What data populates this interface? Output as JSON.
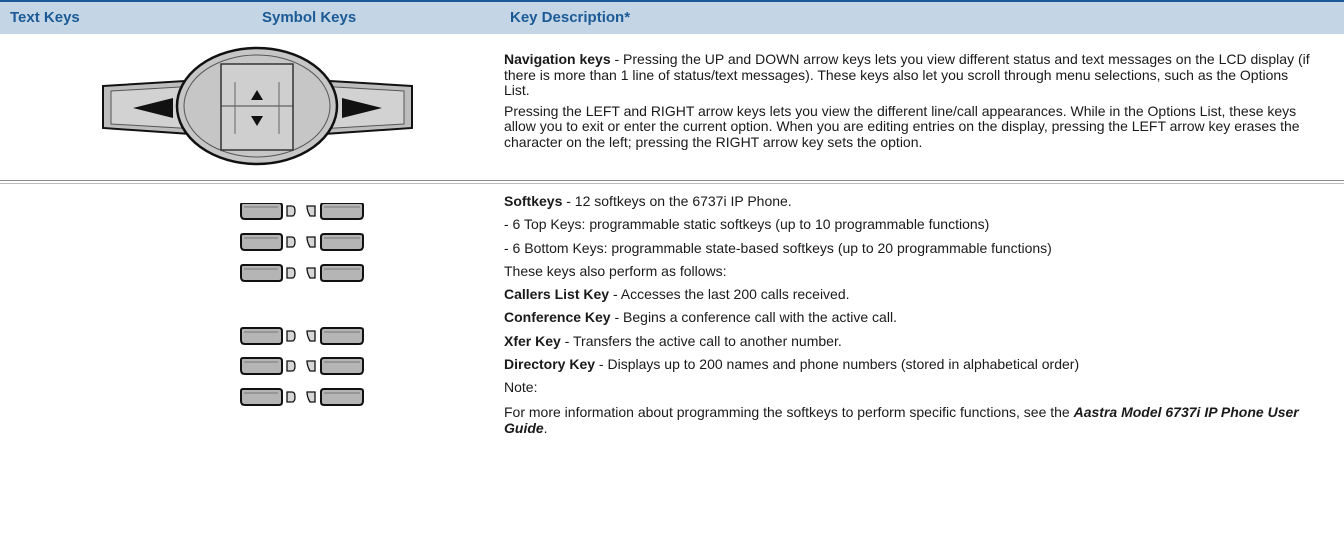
{
  "header": {
    "col1": "Text Keys",
    "col2": "Symbol Keys",
    "col3": "Key Description*"
  },
  "nav": {
    "title": "Navigation keys",
    "text1": " - Pressing the UP and DOWN arrow keys lets you view different status and text messages on the LCD display (if there is more than 1 line of status/text messages). These keys also let you scroll through menu selections, such as the Options List.",
    "text2": "Pressing the LEFT and RIGHT arrow keys lets you view the different line/call appearances. While in the Options List, these keys allow you to exit or enter the current option. When you are editing entries on the display, pressing the LEFT arrow key erases the character on the left; pressing the RIGHT arrow key sets the option."
  },
  "softkeys": {
    "title": "Softkeys",
    "intro": " - 12 softkeys on the 6737i IP Phone.",
    "line_top": "- 6 Top Keys: programmable static softkeys (up to 10 programmable functions)",
    "line_bottom": "- 6 Bottom Keys: programmable state-based softkeys (up to 20 programmable functions)",
    "line_also": "These keys also perform as follows:",
    "callers_title": "Callers List Key",
    "callers_text": " - Accesses the last 200 calls received.",
    "conf_title": "Conference Key",
    "conf_text": " - Begins a conference call with the active call.",
    "xfer_title": "Xfer Key",
    "xfer_text": " - Transfers the active call to another number.",
    "dir_title": "Directory Key",
    "dir_text": " - Displays up to 200 names and phone numbers (stored in alphabetical order)",
    "note_label": "Note:",
    "more_pre": "For more information about programming the softkeys to perform specific functions, see the ",
    "guide": "Aastra Model 6737i IP Phone User Guide",
    "more_post": "."
  },
  "colors": {
    "header_bg": "#c4d6e6",
    "header_text": "#1b5a96",
    "key_fill": "#b9b9b9",
    "key_outline": "#111111"
  },
  "icons": [
    "arrow-left-icon",
    "arrow-right-icon",
    "arrow-up-icon",
    "arrow-down-icon",
    "softkey-icon",
    "softkey-led-icon"
  ]
}
